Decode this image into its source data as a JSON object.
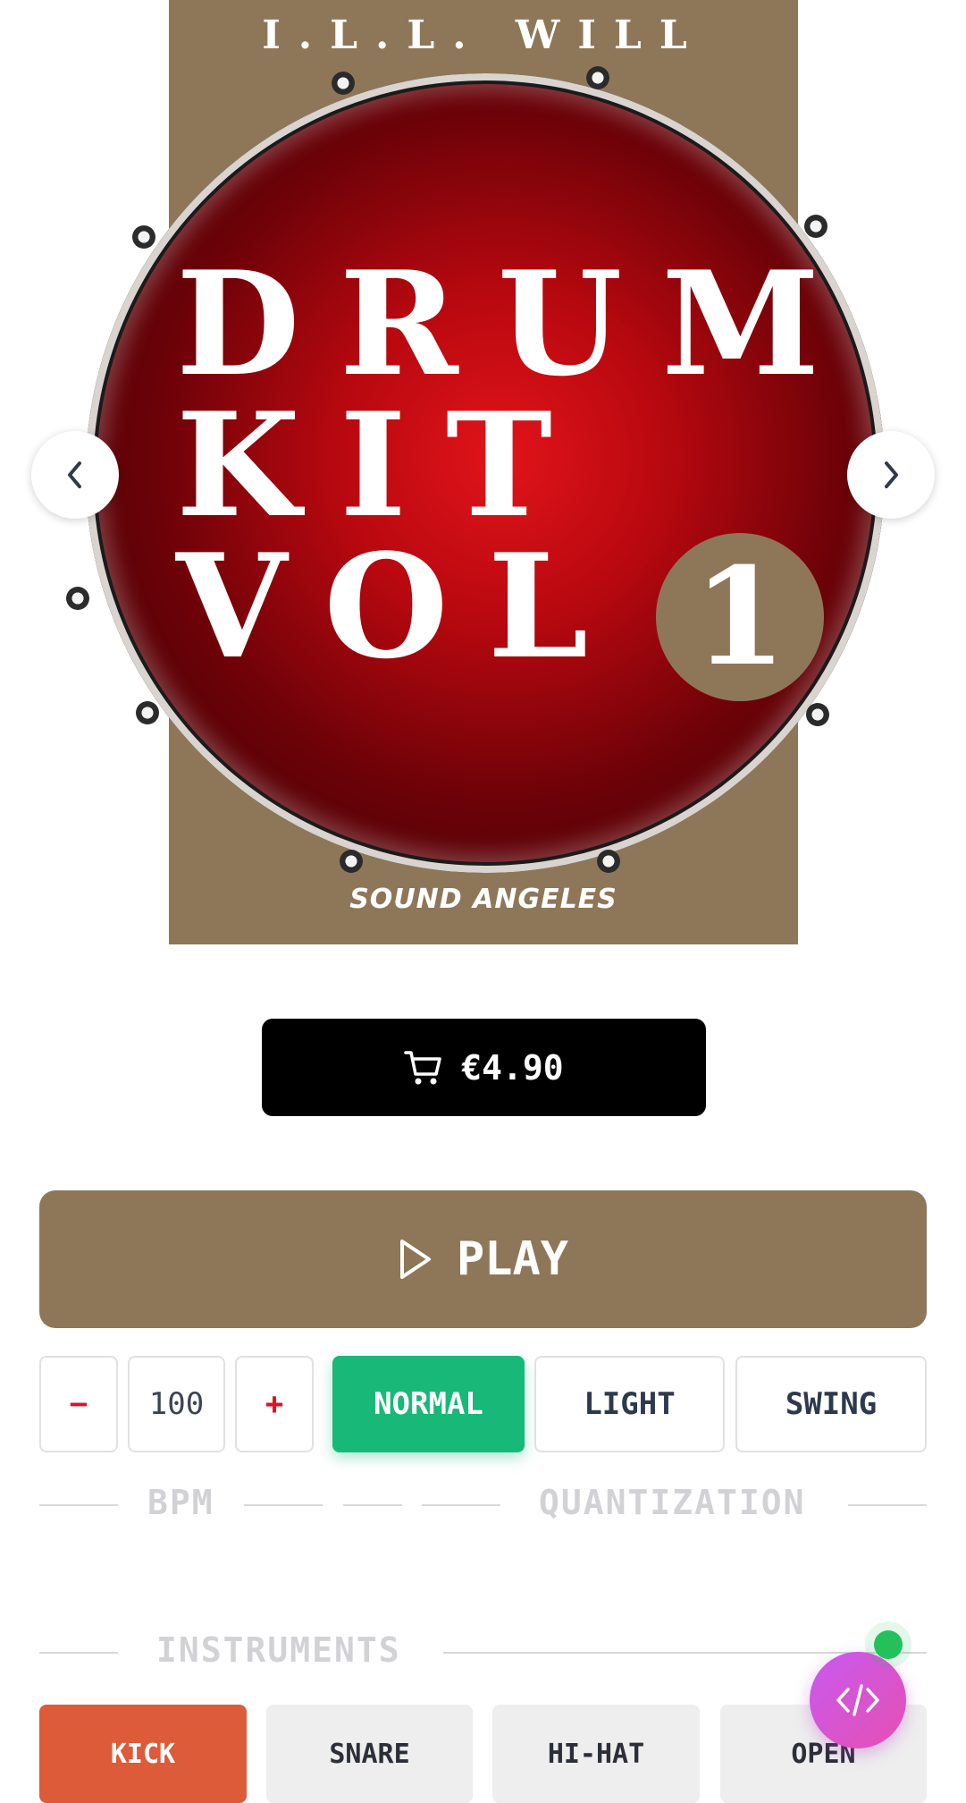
{
  "cover": {
    "artist": "I.L.L. WILL",
    "title_line1": "DRUM",
    "title_line2": "KIT",
    "title_line3": "VOL",
    "volume": "1",
    "label": "SOUND ANGELES",
    "background_color": "#8e7758"
  },
  "carousel": {
    "prev_icon": "chevron-left-icon",
    "next_icon": "chevron-right-icon"
  },
  "buy": {
    "icon": "cart-icon",
    "price": "€4.90"
  },
  "player": {
    "play_icon": "play-icon",
    "play_label": "PLAY"
  },
  "bpm": {
    "decrement_label": "−",
    "value": "100",
    "increment_label": "+",
    "section_label": "BPM"
  },
  "quantization": {
    "section_label": "QUANTIZATION",
    "options": [
      "NORMAL",
      "LIGHT",
      "SWING"
    ],
    "selected": "NORMAL",
    "active_color": "#17b878"
  },
  "instruments": {
    "section_label": "INSTRUMENTS",
    "items": [
      "KICK",
      "SNARE",
      "HI-HAT",
      "OPEN"
    ],
    "selected": "KICK",
    "active_color": "#dd5b38"
  },
  "fab": {
    "icon": "code-icon"
  }
}
